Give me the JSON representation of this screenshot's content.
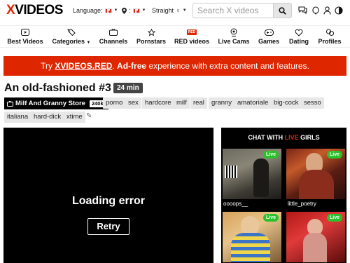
{
  "header": {
    "logo_x": "X",
    "logo_rest": "VIDEOS",
    "language_label": "Language:",
    "orientation_label": "Straight",
    "search_placeholder": "Search X videos"
  },
  "nav": [
    {
      "label": "Best Videos",
      "icon": "play-square-icon"
    },
    {
      "label": "Categories",
      "icon": "tags-icon"
    },
    {
      "label": "Channels",
      "icon": "tv-icon"
    },
    {
      "label": "Pornstars",
      "icon": "star-icon"
    },
    {
      "label": "RED videos",
      "icon": "red-icon",
      "badge": "RED"
    },
    {
      "label": "Live Cams",
      "icon": "webcam-icon"
    },
    {
      "label": "Games",
      "icon": "gamepad-icon"
    },
    {
      "label": "Dating",
      "icon": "hearts-icon"
    },
    {
      "label": "Profiles",
      "icon": "faces-icon"
    }
  ],
  "banner": {
    "pre": "Try ",
    "link": "XVIDEOS.RED",
    "mid": ". ",
    "adfree": "Ad-free",
    "post": " experience with extra content and features."
  },
  "video": {
    "title": "An old-fashioned #3",
    "duration": "24 min",
    "uploader": "Milf And Granny Store",
    "uploader_count": "240k",
    "tags": [
      "porno",
      "sex",
      "hardcore",
      "milf",
      "real",
      "granny",
      "amatoriale",
      "big-cock",
      "sesso",
      "italiana",
      "hard-dick",
      "xtime"
    ]
  },
  "player": {
    "error": "Loading error",
    "retry": "Retry"
  },
  "live": {
    "head_pre": "CHAT WITH ",
    "head_live": "LIVE",
    "head_post": " GIRLS",
    "badge": "Live",
    "cams": [
      {
        "name": "oooops__"
      },
      {
        "name": "little_poetry"
      },
      {
        "name": ""
      },
      {
        "name": ""
      }
    ]
  },
  "colors": {
    "brand_red": "#de2600",
    "live_green": "#2ac12a"
  }
}
